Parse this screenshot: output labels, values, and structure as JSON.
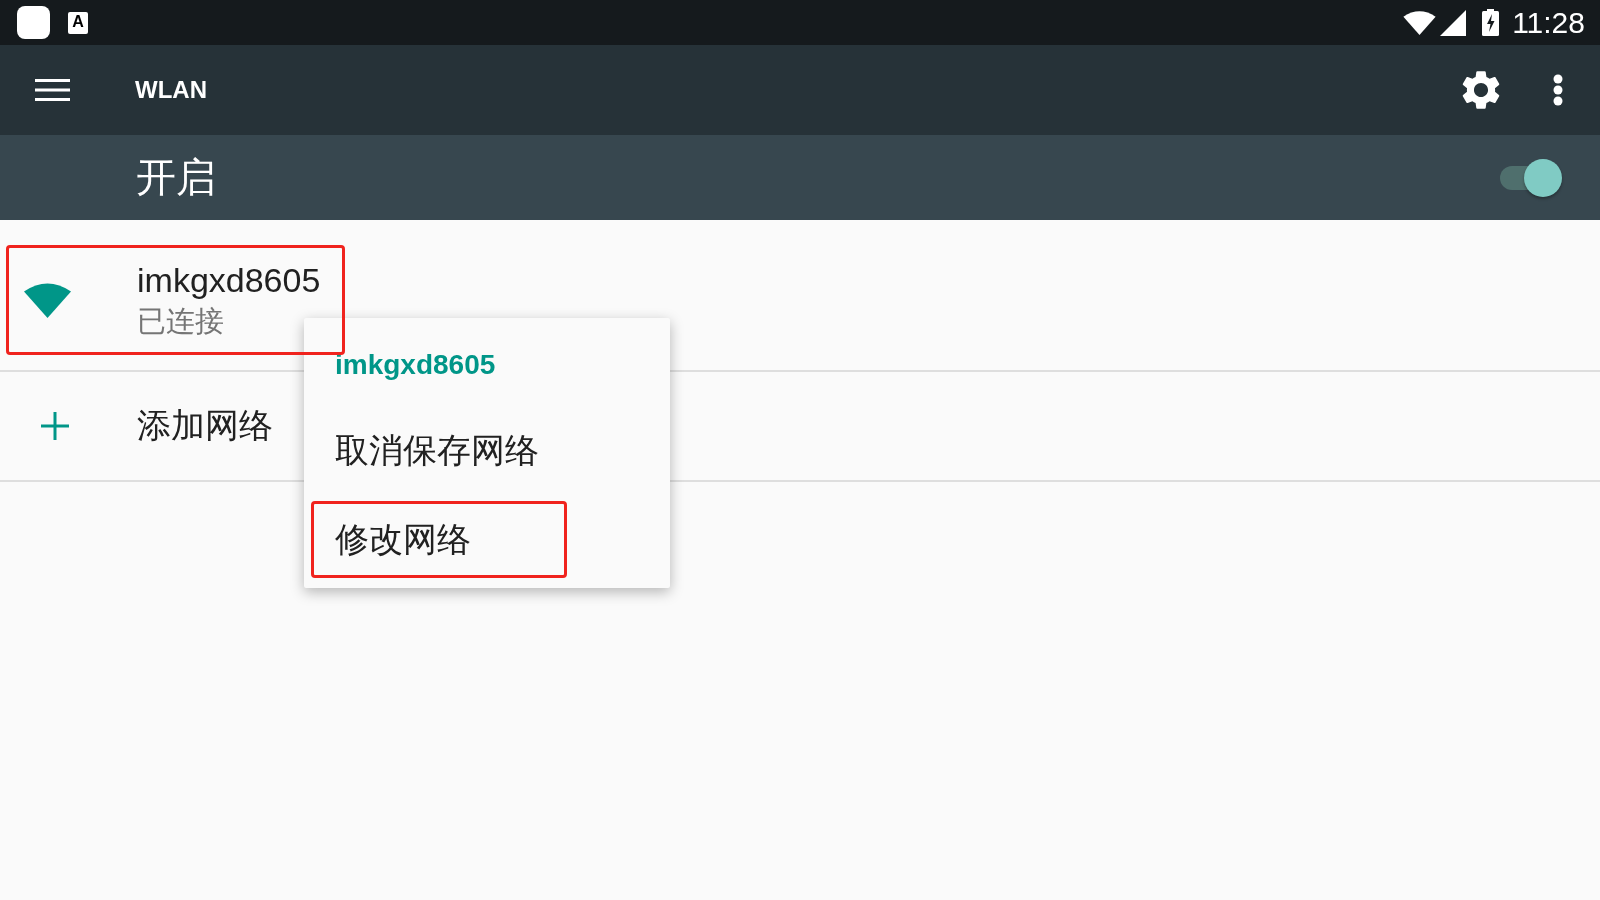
{
  "status_bar": {
    "input_badge": "A",
    "time": "11:28"
  },
  "toolbar": {
    "title": "WLAN"
  },
  "wifi_switch": {
    "label": "开启",
    "on": true
  },
  "networks": [
    {
      "kind": "network",
      "name": "imkgxd8605",
      "status": "已连接",
      "highlighted": true
    },
    {
      "kind": "add",
      "label": "添加网络",
      "highlighted": false
    }
  ],
  "context_menu": {
    "title": "imkgxd8605",
    "items": [
      {
        "label": "取消保存网络",
        "highlighted": false
      },
      {
        "label": "修改网络",
        "highlighted": true
      }
    ]
  }
}
